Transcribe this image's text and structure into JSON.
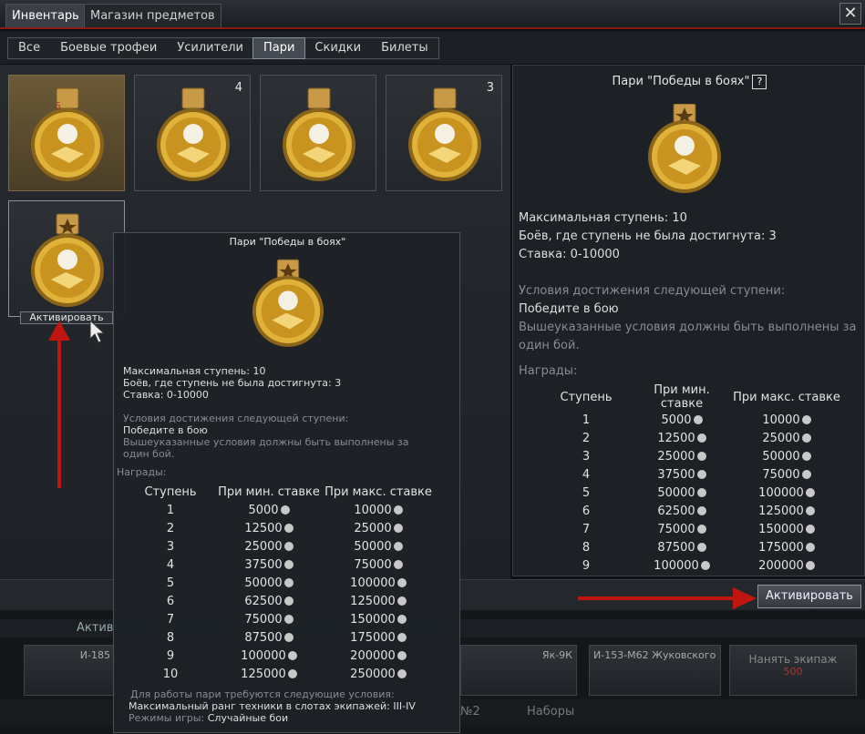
{
  "top_tabs": [
    "Инвентарь",
    "Магазин предметов"
  ],
  "close_label": "✕",
  "filter_tabs": [
    "Все",
    "Боевые трофеи",
    "Усилители",
    "Пари",
    "Скидки",
    "Билеты"
  ],
  "slots": [
    {
      "count": "",
      "badge": "5"
    },
    {
      "count": "4",
      "badge": ""
    },
    {
      "count": "",
      "badge": ""
    },
    {
      "count": "3",
      "badge": ""
    },
    {
      "count": "",
      "badge": ""
    }
  ],
  "activate_tag": "Активировать",
  "detail": {
    "title": "Пари \"Победы в боях\"",
    "help": "?",
    "max_stage": "Максимальная ступень: 10",
    "battles_failed": "Боёв, где ступень не была достигнута: 3",
    "bet": "Ставка: 0-10000",
    "cond_header": "Условия достижения следующей ступени:",
    "cond": "Победите в бою",
    "cond_note_1": "Вышеуказанные условия должны быть выполнены за",
    "cond_note_2": "один бой.",
    "rewards_header": "Награды:",
    "col_stage": "Ступень",
    "col_min": "При мин. ставке",
    "col_max": "При макс. ставке"
  },
  "rewards": [
    {
      "stage": "1",
      "min": "5000",
      "max": "10000"
    },
    {
      "stage": "2",
      "min": "12500",
      "max": "25000"
    },
    {
      "stage": "3",
      "min": "25000",
      "max": "50000"
    },
    {
      "stage": "4",
      "min": "37500",
      "max": "75000"
    },
    {
      "stage": "5",
      "min": "50000",
      "max": "100000"
    },
    {
      "stage": "6",
      "min": "62500",
      "max": "125000"
    },
    {
      "stage": "7",
      "min": "75000",
      "max": "150000"
    },
    {
      "stage": "8",
      "min": "87500",
      "max": "175000"
    },
    {
      "stage": "9",
      "min": "100000",
      "max": "200000"
    },
    {
      "stage": "10",
      "min": "125000",
      "max": "250000"
    }
  ],
  "tooltip": {
    "title": "Пари \"Победы в боях\"",
    "req_header": "Для работы пари требуются следующие условия:",
    "req_rank": "Максимальный ранг техники в слотах экипажей: III-IV",
    "req_mode_label": "Режимы игры:",
    "req_mode": "Случайные бои"
  },
  "bottom": {
    "activate_button": "Активировать",
    "crew_label": "Актив",
    "vehicles": [
      "И-185",
      "Як-9К",
      "И-153-М62 Жуковского"
    ],
    "hire_label": "Нанять экипаж",
    "hire_cost": "500",
    "preset": "№2",
    "presets": "Наборы"
  },
  "colors": {
    "accent_red": "#c0160f",
    "gold": "#d4a52f",
    "selected_slot": "#6b5a37"
  }
}
